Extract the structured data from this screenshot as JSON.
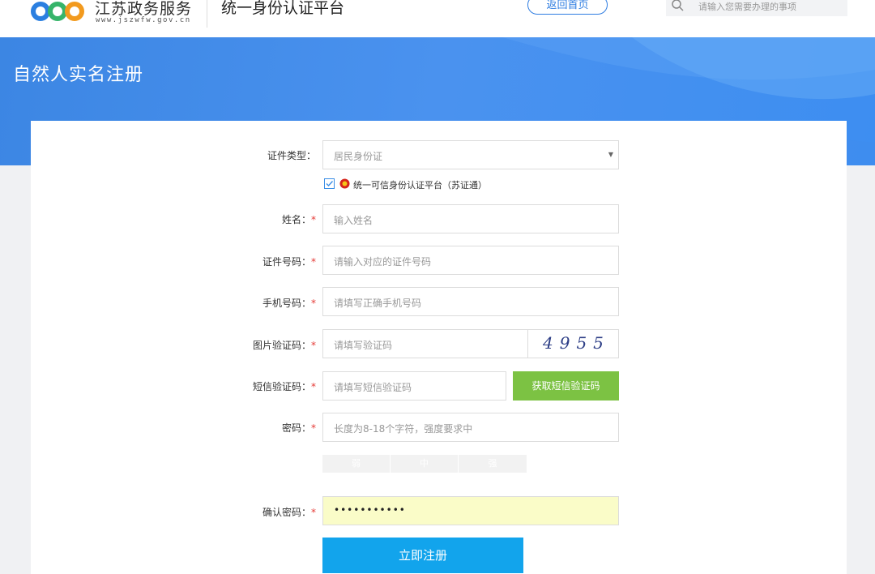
{
  "header": {
    "site_name": "江苏政务服务",
    "site_url": "www.jszwfw.gov.cn",
    "platform_title": "统一身份认证平台",
    "home_button": "返回首页",
    "search_placeholder": "请输入您需要办理的事项"
  },
  "banner": {
    "title": "自然人实名注册"
  },
  "form": {
    "id_type": {
      "label": "证件类型：",
      "value": "居民身份证"
    },
    "trusted_platform": "统一可信身份认证平台（苏证通）",
    "name": {
      "label": "姓名：",
      "placeholder": "输入姓名"
    },
    "id_number": {
      "label": "证件号码：",
      "placeholder": "请输入对应的证件号码"
    },
    "phone": {
      "label": "手机号码：",
      "placeholder": "请填写正确手机号码"
    },
    "captcha": {
      "label": "图片验证码：",
      "placeholder": "请填写验证码",
      "code": "4955"
    },
    "sms": {
      "label": "短信验证码：",
      "placeholder": "请填写短信验证码",
      "button": "获取短信验证码"
    },
    "password": {
      "label": "密码：",
      "placeholder": "长度为8-18个字符，强度要求中"
    },
    "strength": [
      "弱",
      "中",
      "强"
    ],
    "confirm": {
      "label": "确认密码：",
      "value": "•••••••••••"
    },
    "required_mark": "*",
    "submit": "立即注册"
  },
  "colors": {
    "banner": "#4a92ef",
    "sms_button": "#7cc243",
    "submit_button": "#12a4ec",
    "required": "#e53935"
  }
}
